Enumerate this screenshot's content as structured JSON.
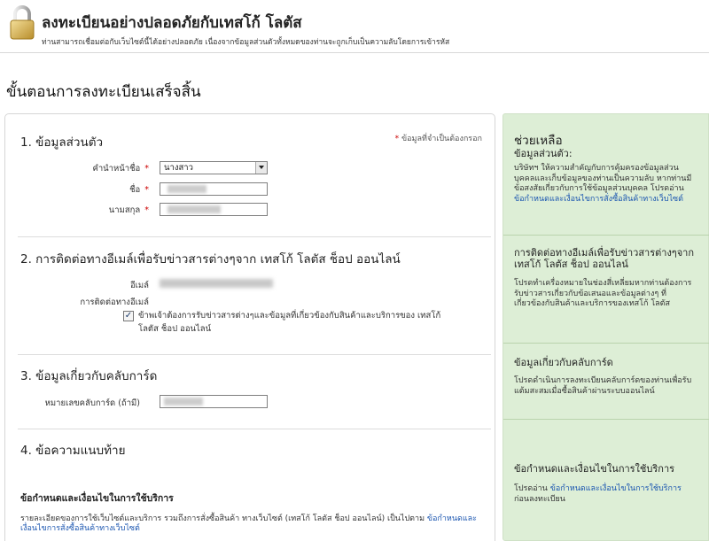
{
  "header": {
    "title": "ลงทะเบียนอย่างปลอดภัยกับเทสโก้ โลตัส",
    "subtitle": "ท่านสามารถเชื่อมต่อกับเว็บไซต์นี้ได้อย่างปลอดภัย เนื่องจากข้อมูลส่วนตัวทั้งหมดของท่านจะถูกเก็บเป็นความลับโดยการเข้ารหัส"
  },
  "page_title": "ขั้นตอนการลงทะเบียนเสร็จสิ้น",
  "main": {
    "required_note_star": "*",
    "required_note": "ข้อมูลที่จำเป็นต้องกรอก",
    "section1": {
      "title": "1. ข้อมูลส่วนตัว",
      "prefix_label": "คำนำหน้าชื่อ",
      "prefix_value": "นางสาว",
      "firstname_label": "ชื่อ",
      "lastname_label": "นามสกุล",
      "star": "*"
    },
    "section2": {
      "title": "2. การติดต่อทางอีเมล์เพื่อรับข่าวสารต่างๆจาก เทสโก้ โลตัส ช็อป ออนไลน์",
      "email_label": "อีเมล์",
      "contact_label": "การติดต่อทางอีเมล์",
      "checkbox_checked": true,
      "checkbox_mark": "✓",
      "checkbox_text": "ข้าพเจ้าต้องการรับข่าวสารต่างๆและข้อมูลที่เกี่ยวข้องกับสินค้าและบริการของ เทสโก้ โลตัส ช็อป ออนไลน์"
    },
    "section3": {
      "title": "3. ข้อมูลเกี่ยวกับคลับการ์ด",
      "card_label": "หมายเลขคลับการ์ด (ถ้ามี)"
    },
    "section4": {
      "title": "4. ข้อความแนบท้าย",
      "terms_title": "ข้อกำหนดและเงื่อนไขในการใช้บริการ",
      "terms_text": "รายละเอียดของการใช้เว็บไซต์และบริการ รวมถึงการสั่งซื้อสินค้า ทางเว็บไซต์ (เทสโก้ โลตัส ช็อป ออนไลน์) เป็นไปตาม",
      "terms_link": "ข้อกำหนดและเงื่อนไขการสั่งซื้อสินค้าทางเว็บไซต์"
    }
  },
  "help": {
    "title": "ช่วยเหลือ",
    "block1_title": "ข้อมูลส่วนตัว:",
    "block1_text": "บริษัทฯ ให้ความสำคัญกับการคุ้มครองข้อมูลส่วนบุคคลและเก็บข้อมูลของท่านเป็นความลับ หากท่านมีข้อสงสัยเกี่ยวกับการใช้ข้อมูลส่วนบุคคล โปรดอ่าน",
    "block1_link": "ข้อกำหนดและเงื่อนไขการสั่งซื้อสินค้าทางเว็บไซต์",
    "block2_title": "การติดต่อทางอีเมล์เพื่อรับข่าวสารต่างๆจาก เทสโก้ โลตัส ช็อป ออนไลน์",
    "block2_text": "โปรดทำเครื่องหมายในช่องสี่เหลี่ยมหากท่านต้องการรับข่าวสารเกี่ยวกับข้อเสนอและข้อมูลต่างๆ ที่เกี่ยวข้องกับสินค้าและบริการของเทสโก้ โลตัส",
    "block3_title": "ข้อมูลเกี่ยวกับคลับการ์ด",
    "block3_text": "โปรดดำเนินการลงทะเบียนคลับการ์ดของท่านเพื่อรับแต้มสะสมเมื่อซื้อสินค้าผ่านระบบออนไลน์",
    "block4_title": "ข้อกำหนดและเงื่อนไขในการใช้บริการ",
    "block4_text_a": "โปรดอ่าน",
    "block4_link": "ข้อกำหนดและเงื่อนไขในการใช้บริการ",
    "block4_text_b": "ก่อนลงทะเบียน"
  }
}
